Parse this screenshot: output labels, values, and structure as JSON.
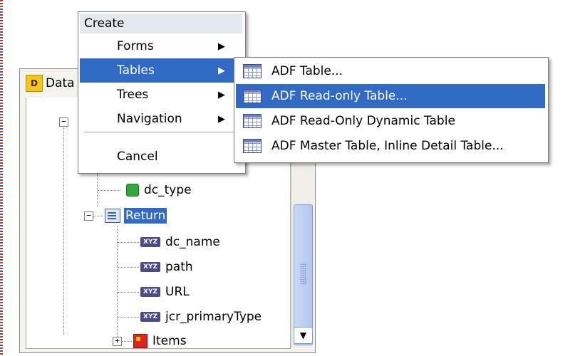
{
  "panel": {
    "title": "Data",
    "tree": {
      "nodes": [
        {
          "label": "dc_type",
          "icon": "cube-icon"
        },
        {
          "label": "Return",
          "icon": "return-icon",
          "selected": true
        },
        {
          "label": "dc_name",
          "icon": "xyz-icon"
        },
        {
          "label": "path",
          "icon": "xyz-icon"
        },
        {
          "label": "URL",
          "icon": "xyz-icon"
        },
        {
          "label": "jcr_primaryType",
          "icon": "xyz-icon"
        },
        {
          "label": "Items",
          "icon": "items-icon"
        }
      ],
      "xyz_glyph": "XYZ"
    }
  },
  "create_menu": {
    "header": "Create",
    "items": [
      {
        "label": "Forms",
        "arrow": "▶"
      },
      {
        "label": "Tables",
        "arrow": "▶",
        "active": true
      },
      {
        "label": "Trees",
        "arrow": "▶"
      },
      {
        "label": "Navigation",
        "arrow": "▶"
      },
      {
        "label": "Cancel"
      }
    ]
  },
  "tables_submenu": {
    "items": [
      {
        "label": "ADF Table..."
      },
      {
        "label": "ADF Read-only Table...",
        "active": true
      },
      {
        "label": "ADF Read-Only Dynamic Table"
      },
      {
        "label": "ADF Master Table, Inline Detail Table..."
      }
    ]
  },
  "colors": {
    "selection": "#316ac5",
    "menu_header": "#e4e8f0",
    "panel_bg": "#f4f3ee"
  }
}
